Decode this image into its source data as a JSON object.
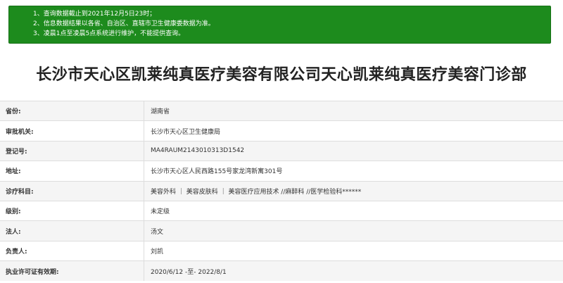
{
  "notice": {
    "lines": [
      "1、查询数据截止到2021年12月5日23时；",
      "2、信息数据结果以各省、自治区、直辖市卫生健康委数据为准。",
      "3、凌晨1点至凌晨5点系统进行维护，不能提供查询。"
    ]
  },
  "title": "长沙市天心区凯莱纯真医疗美容有限公司天心凯莱纯真医疗美容门诊部",
  "rows": [
    {
      "label": "省份:",
      "value": "湖南省"
    },
    {
      "label": "审批机关:",
      "value": "长沙市天心区卫生健康局"
    },
    {
      "label": "登记号:",
      "value": "MA4RAUM2143010313D1542"
    },
    {
      "label": "地址:",
      "value": "长沙市天心区人民西路155号家龙湾新寓301号"
    },
    {
      "label": "诊疗科目:",
      "value": "美容外科 ｜ 美容皮肤科 ｜ 美容医疗应用技术 //麻醉科 //医学检验科******"
    },
    {
      "label": "级别:",
      "value": "未定级"
    },
    {
      "label": "法人:",
      "value": "汤文"
    },
    {
      "label": "负责人:",
      "value": "刘凯"
    },
    {
      "label": "执业许可证有效期:",
      "value": "2020/6/12 -至- 2022/8/1"
    }
  ],
  "colors": {
    "notice_bg": "#1d8b1d",
    "row_alt": "#f5f5f5",
    "border": "#dddddd"
  }
}
